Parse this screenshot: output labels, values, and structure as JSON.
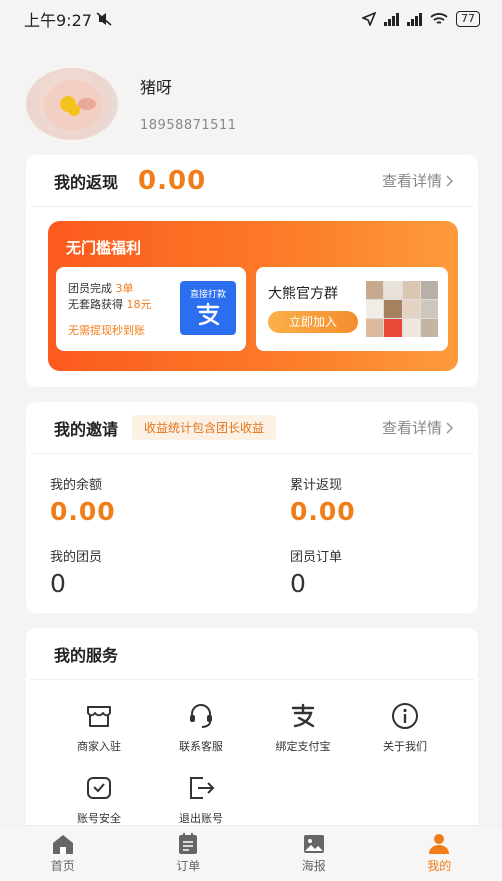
{
  "status_bar": {
    "time": "上午9:27",
    "battery": "77"
  },
  "profile": {
    "name": "猪呀",
    "phone": "18958871511"
  },
  "rebate": {
    "title": "我的返现",
    "amount": "0.00",
    "detail_link": "查看详情",
    "banner": {
      "title": "无门槛福利",
      "card1": {
        "line1_prefix": "团员完成 ",
        "line1_highlight": "3单",
        "line2_prefix": "无套路获得 ",
        "line2_highlight": "18元",
        "line3": "无需提现秒到账",
        "pay_label": "直接打款",
        "pay_icon": "alipay-icon"
      },
      "card2": {
        "title": "大熊官方群",
        "join_label": "立即加入"
      }
    }
  },
  "invite": {
    "title": "我的邀请",
    "tag": "收益统计包含团长收益",
    "detail_link": "查看详情",
    "stats": [
      {
        "label": "我的余额",
        "value": "0.00"
      },
      {
        "label": "累计返现",
        "value": "0.00"
      },
      {
        "label": "我的团员",
        "value": "0"
      },
      {
        "label": "团员订单",
        "value": "0"
      }
    ]
  },
  "services": {
    "title": "我的服务",
    "items": [
      {
        "label": "商家入驻",
        "icon": "store-icon"
      },
      {
        "label": "联系客服",
        "icon": "headset-icon"
      },
      {
        "label": "绑定支付宝",
        "icon": "alipay-icon"
      },
      {
        "label": "关于我们",
        "icon": "info-icon"
      },
      {
        "label": "账号安全",
        "icon": "shield-icon"
      },
      {
        "label": "退出账号",
        "icon": "logout-icon"
      }
    ]
  },
  "bottom_nav": [
    {
      "label": "首页",
      "icon": "home-icon"
    },
    {
      "label": "订单",
      "icon": "order-icon"
    },
    {
      "label": "海报",
      "icon": "poster-icon"
    },
    {
      "label": "我的",
      "icon": "user-icon",
      "active": true
    }
  ],
  "colors": {
    "accent": "#f07d1a",
    "banner_start": "#fb5a1d",
    "banner_end": "#fd9b3c",
    "alipay_blue": "#2b6ff0"
  }
}
